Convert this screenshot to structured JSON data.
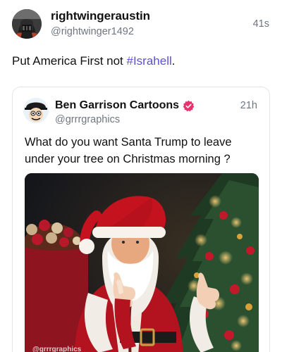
{
  "post": {
    "author": {
      "display_name": "rightwingeraustin",
      "handle": "@rightwinger1492",
      "avatar_icon": "helmeted-figure-avatar"
    },
    "timestamp": "41s",
    "text_before": "Put America First not ",
    "hashtag": "#Israhell",
    "text_after": ".",
    "hashtag_color": "#5b4fd6"
  },
  "quoted_post": {
    "author": {
      "display_name": "Ben Garrison Cartoons",
      "handle": "@grrrgraphics",
      "verified": true,
      "verified_icon": "verified-badge-icon",
      "verified_color": "#e8336d",
      "avatar_icon": "cartoon-face-avatar"
    },
    "timestamp": "21h",
    "text": "What do you want Santa Trump to leave under your tree on Christmas morning ?",
    "media": {
      "description_icon": "santa-christmas-tree-image",
      "watermark": "@grrrgraphics"
    }
  }
}
